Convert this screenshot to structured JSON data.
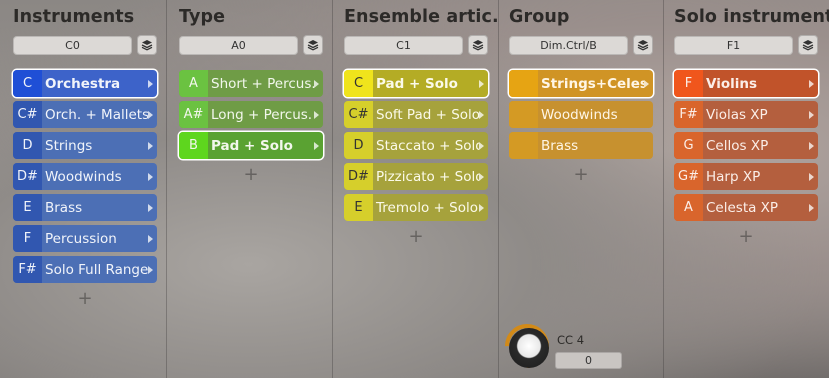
{
  "columns": [
    {
      "title": "Instruments",
      "key": "C0",
      "items": [
        {
          "key": "C",
          "label": "Orchestra",
          "selected": true
        },
        {
          "key": "C#",
          "label": "Orch. + Mallets"
        },
        {
          "key": "D",
          "label": "Strings"
        },
        {
          "key": "D#",
          "label": "Woodwinds"
        },
        {
          "key": "E",
          "label": "Brass"
        },
        {
          "key": "F",
          "label": "Percussion"
        },
        {
          "key": "F#",
          "label": "Solo Full Range"
        }
      ]
    },
    {
      "title": "Type",
      "key": "A0",
      "items": [
        {
          "key": "A",
          "label": "Short + Percus."
        },
        {
          "key": "A#",
          "label": "Long + Percus."
        },
        {
          "key": "B",
          "label": "Pad + Solo",
          "selected": true
        }
      ]
    },
    {
      "title": "Ensemble artic.",
      "key": "C1",
      "items": [
        {
          "key": "C",
          "label": "Pad + Solo",
          "selected": true
        },
        {
          "key": "C#",
          "label": "Soft Pad + Solo"
        },
        {
          "key": "D",
          "label": "Staccato + Solo"
        },
        {
          "key": "D#",
          "label": "Pizzicato + Solo"
        },
        {
          "key": "E",
          "label": "Tremolo + Solo"
        }
      ]
    },
    {
      "title": "Group",
      "key": "Dim.Ctrl/B",
      "items": [
        {
          "key": "",
          "label": "Strings+Celesta",
          "selected": true
        },
        {
          "key": "",
          "label": "Woodwinds"
        },
        {
          "key": "",
          "label": "Brass"
        }
      ]
    },
    {
      "title": "Solo instrument",
      "key": "F1",
      "items": [
        {
          "key": "F",
          "label": "Violins",
          "selected": true
        },
        {
          "key": "F#",
          "label": "Violas XP"
        },
        {
          "key": "G",
          "label": "Cellos XP"
        },
        {
          "key": "G#",
          "label": "Harp XP"
        },
        {
          "key": "A",
          "label": "Celesta XP"
        }
      ]
    }
  ],
  "add_symbol": "+",
  "icons": {
    "stack": "layers-icon",
    "add": "plus-icon",
    "arrow": "chevron-right-icon"
  },
  "colors": {
    "instruments": "#3157b0",
    "type": "#6bc241",
    "ensemble": "#d6cf2b",
    "group": "#d49a24",
    "solo": "#d9652c"
  },
  "cc": {
    "label": "CC 4",
    "value": "0"
  }
}
